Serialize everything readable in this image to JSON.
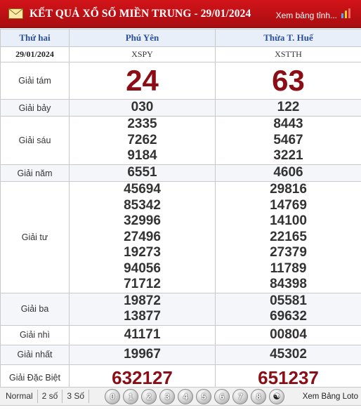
{
  "header": {
    "title": "KẾT QUẢ XỔ SỐ MIỀN TRUNG - 29/01/2024",
    "view_table_link": "Xem bảng tỉnh...",
    "accent_color": "#c8141a"
  },
  "table": {
    "day": "Thứ hai",
    "date": "29/01/2024",
    "provinces": [
      {
        "name": "Phú Yên",
        "code": "XSPY"
      },
      {
        "name": "Thừa T. Huế",
        "code": "XSTTH"
      }
    ],
    "prizes": [
      {
        "label": "Giải tám",
        "values": [
          [
            "24"
          ],
          [
            "63"
          ]
        ]
      },
      {
        "label": "Giải bảy",
        "values": [
          [
            "030"
          ],
          [
            "122"
          ]
        ]
      },
      {
        "label": "Giải sáu",
        "values": [
          [
            "2335",
            "7262",
            "9184"
          ],
          [
            "8443",
            "5467",
            "3221"
          ]
        ]
      },
      {
        "label": "Giải năm",
        "values": [
          [
            "6551"
          ],
          [
            "4606"
          ]
        ]
      },
      {
        "label": "Giải tư",
        "values": [
          [
            "45694",
            "85342",
            "32996",
            "27496",
            "19273",
            "94056",
            "71712"
          ],
          [
            "29816",
            "14769",
            "14100",
            "22165",
            "27379",
            "11789",
            "84398"
          ]
        ]
      },
      {
        "label": "Giải ba",
        "values": [
          [
            "19872",
            "13877"
          ],
          [
            "05581",
            "69632"
          ]
        ]
      },
      {
        "label": "Giải nhì",
        "values": [
          [
            "41171"
          ],
          [
            "00804"
          ]
        ]
      },
      {
        "label": "Giải nhất",
        "values": [
          [
            "19967"
          ],
          [
            "45302"
          ]
        ]
      },
      {
        "label": "Giải Đặc Biệt",
        "values": [
          [
            "632127"
          ],
          [
            "651237"
          ]
        ]
      }
    ]
  },
  "footer": {
    "options": [
      "Normal",
      "2 số",
      "3 Số"
    ],
    "digits": [
      "0",
      "1",
      "2",
      "3",
      "4",
      "5",
      "6",
      "7",
      "8",
      "9"
    ],
    "loto_link": "Xem Bảng Loto"
  }
}
